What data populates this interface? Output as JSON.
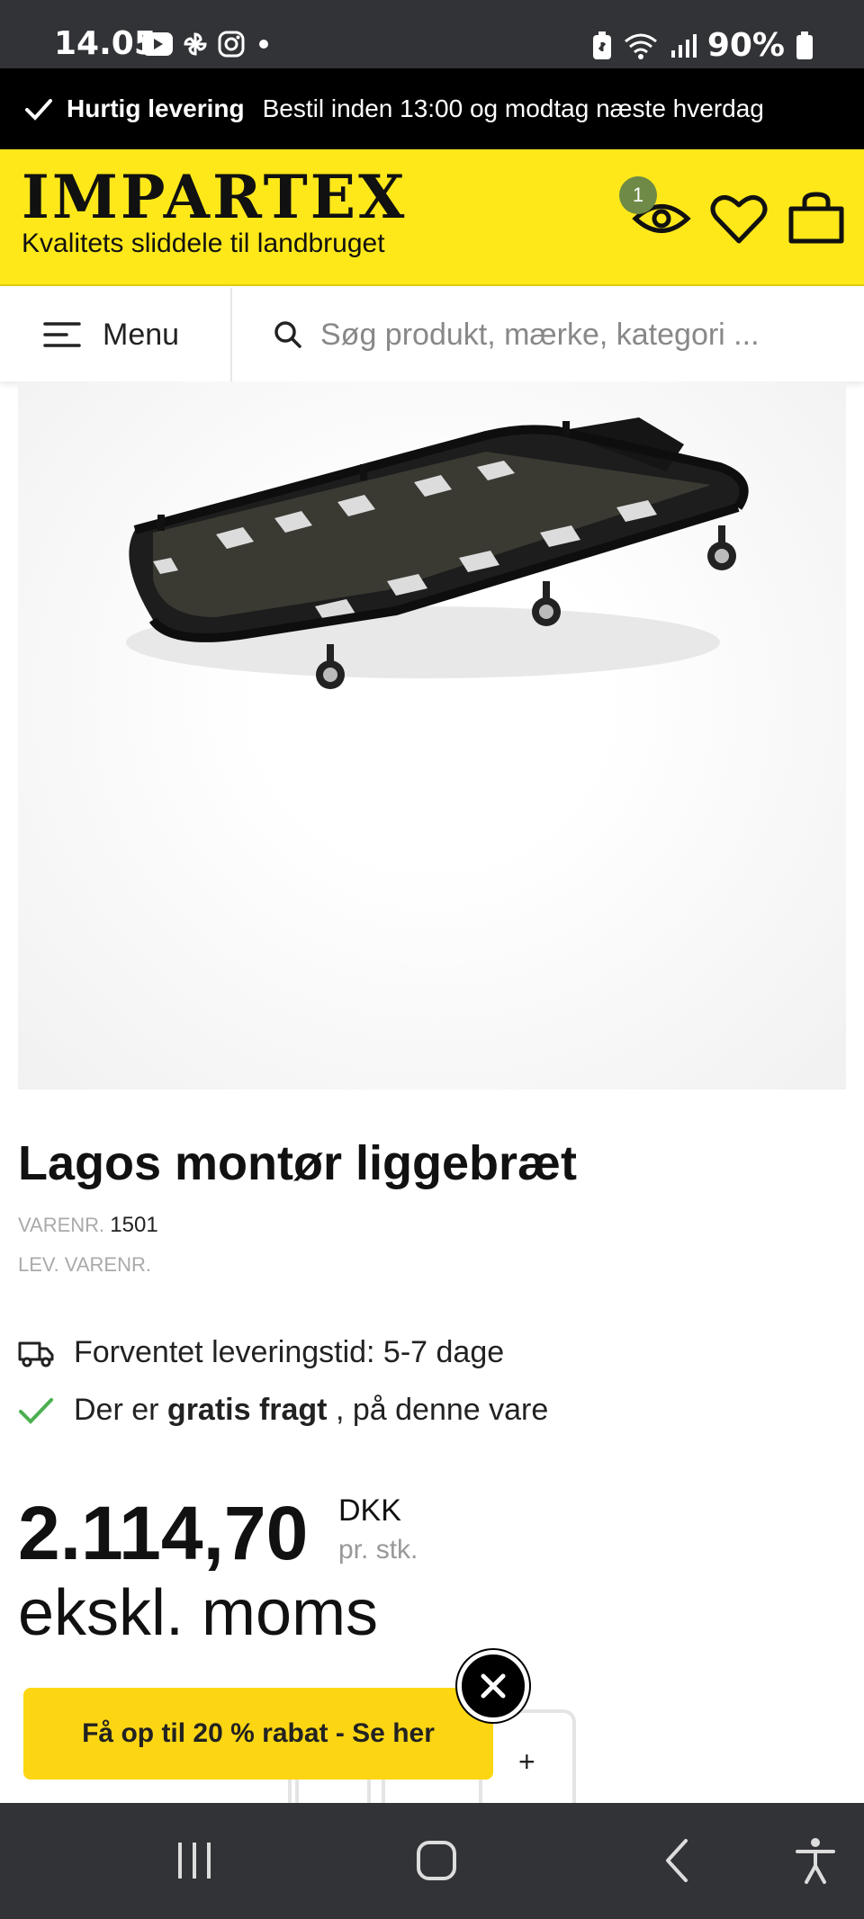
{
  "status_bar": {
    "time": "14.05",
    "battery": "90%",
    "left_icons": [
      "youtube-icon",
      "pinwheel-icon",
      "instagram-icon",
      "dot-icon"
    ],
    "right_icons": [
      "battery-saver-icon",
      "wifi-icon",
      "signal-icon",
      "battery-icon"
    ]
  },
  "promo": {
    "strong": "Hurtig levering",
    "text": "Bestil inden 13:00 og modtag næste hverdag"
  },
  "header": {
    "logo": "IMPARTEX",
    "tagline": "Kvalitets sliddele til landbruget",
    "viewed_count": "1",
    "bg_color": "#ffe81a"
  },
  "nav": {
    "menu_label": "Menu",
    "search_placeholder": "Søg produkt, mærke, kategori ..."
  },
  "product": {
    "title": "Lagos montør liggebræt",
    "sku_label": "VARENR.",
    "sku_value": "1501",
    "supplier_sku_label": "LEV. VARENR.",
    "delivery_text": "Forventet leveringstid: 5-7 dage",
    "freight_pre": "Der er",
    "freight_strong": "gratis fragt",
    "freight_post": ", på denne vare",
    "price": "2.114,70",
    "currency": "DKK",
    "unit": "pr. stk.",
    "vat_note": "ekskl. moms",
    "qty_plus": "+"
  },
  "popup": {
    "discount_label": "Få op til 20 % rabat - Se her",
    "accent_color": "#fdd613"
  },
  "system_nav": {
    "buttons": [
      "recent-apps-icon",
      "home-icon",
      "back-icon",
      "accessibility-icon"
    ]
  }
}
